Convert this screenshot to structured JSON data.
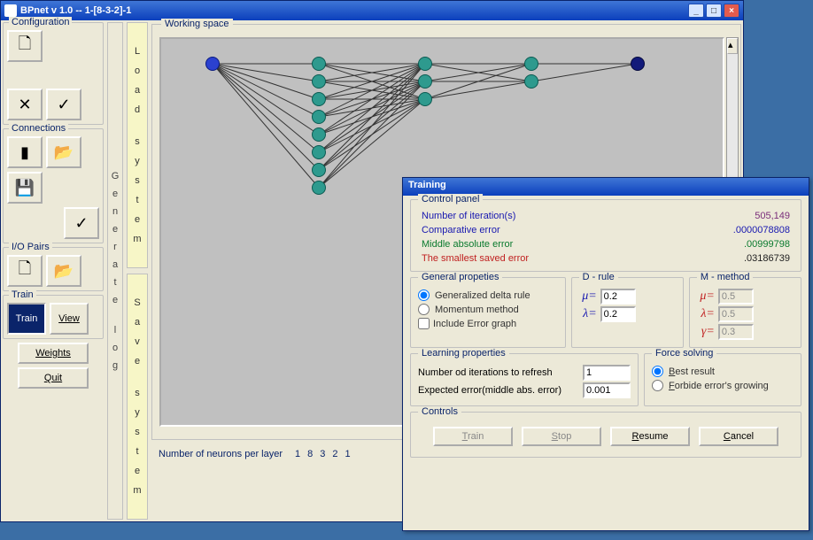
{
  "window": {
    "title": "BPnet v 1.0    --   1-[8-3-2]-1"
  },
  "toolbox": {
    "configuration": {
      "label": "Configuration"
    },
    "connections": {
      "label": "Connections"
    },
    "iopairs": {
      "label": "I/O Pairs"
    },
    "train": {
      "label": "Train",
      "train_btn": "Train",
      "view_btn": "View"
    },
    "weights_btn": "Weights",
    "quit_btn": "Quit"
  },
  "vstrips": {
    "generate": "Generate log",
    "load": "Load system",
    "save": "Save system"
  },
  "workspace": {
    "title": "Working space",
    "footer_label": "Number of neurons per layer",
    "layers": [
      "1",
      "8",
      "3",
      "2",
      "1"
    ]
  },
  "chart_data": {
    "type": "diagram",
    "description": "Fully-connected feedforward neural network 1-8-3-2-1",
    "layers": [
      {
        "name": "input",
        "count": 1,
        "color": "#2b41d0"
      },
      {
        "name": "hidden1",
        "count": 8,
        "color": "#2e9a8e"
      },
      {
        "name": "hidden2",
        "count": 3,
        "color": "#2e9a8e"
      },
      {
        "name": "hidden3",
        "count": 2,
        "color": "#2e9a8e"
      },
      {
        "name": "output",
        "count": 1,
        "color": "#121a7a"
      }
    ],
    "connectivity": "fully-connected between adjacent layers"
  },
  "training": {
    "title": "Training",
    "control_panel_label": "Control panel",
    "iterations_label": "Number of iteration(s)",
    "iterations_value": "505,149",
    "comp_err_label": "Comparative error",
    "comp_err_value": ".0000078808",
    "mid_abs_label": "Middle absolute error",
    "mid_abs_value": ".00999798",
    "smallest_label": "The smallest saved error",
    "smallest_value": ".03186739",
    "general_label": "General propeties",
    "gen_delta": "Generalized delta rule",
    "momentum": "Momentum method",
    "include_err": "Include Error graph",
    "drule_label": "D - rule",
    "mu_symbol": "μ=",
    "mu_value": "0.2",
    "lambda_symbol": "λ=",
    "lambda_value": "0.2",
    "mmethod_label": "M - method",
    "m_mu_symbol": "μ=",
    "m_mu_value": "0.5",
    "m_lambda_symbol": "λ=",
    "m_lambda_value": "0.5",
    "m_gamma_symbol": "γ=",
    "m_gamma_value": "0.3",
    "learning_label": "Learning properties",
    "refresh_label": "Number od iterations to refresh",
    "refresh_value": "1",
    "expected_label": "Expected error(middle abs. error)",
    "expected_value": "0.001",
    "force_label": "Force solving",
    "best_result": "Best result",
    "forbide": "Forbide error's growing",
    "controls_label": "Controls",
    "train_btn": "Train",
    "stop_btn": "Stop",
    "resume_btn": "Resume",
    "cancel_btn": "Cancel"
  }
}
